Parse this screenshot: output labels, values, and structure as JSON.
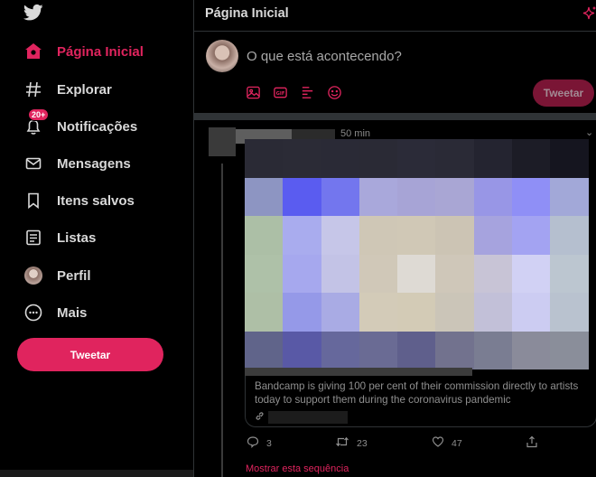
{
  "sidebar": {
    "logo": "twitter-bird-icon",
    "nav": [
      {
        "label": "Página Inicial",
        "icon": "home-icon",
        "active": true
      },
      {
        "label": "Explorar",
        "icon": "hashtag-icon",
        "active": false
      },
      {
        "label": "Notificações",
        "icon": "bell-icon",
        "active": false,
        "badge": "20+"
      },
      {
        "label": "Mensagens",
        "icon": "envelope-icon",
        "active": false
      },
      {
        "label": "Itens salvos",
        "icon": "bookmark-icon",
        "active": false
      },
      {
        "label": "Listas",
        "icon": "list-icon",
        "active": false
      },
      {
        "label": "Perfil",
        "icon": "avatar",
        "active": false
      },
      {
        "label": "Mais",
        "icon": "more-icon",
        "active": false
      }
    ],
    "tweet_button": "Tweetar"
  },
  "main": {
    "title": "Página Inicial",
    "compose": {
      "placeholder": "O que está acontecendo?",
      "tools": [
        "image-icon",
        "gif-icon",
        "poll-icon",
        "emoji-icon"
      ],
      "tweet_button": "Tweetar"
    },
    "tweet": {
      "time": "50 min",
      "card_description": "Bandcamp is giving 100 per cent of their commission directly to artists today to support them during the coronavirus pandemic",
      "actions": {
        "replies": "3",
        "retweets": "23",
        "likes": "47"
      },
      "show_thread": "Mostrar esta sequência"
    }
  },
  "colors": {
    "accent": "#e0245e",
    "background": "#000000",
    "border": "#2f3336",
    "muted": "#8f8f8f"
  }
}
